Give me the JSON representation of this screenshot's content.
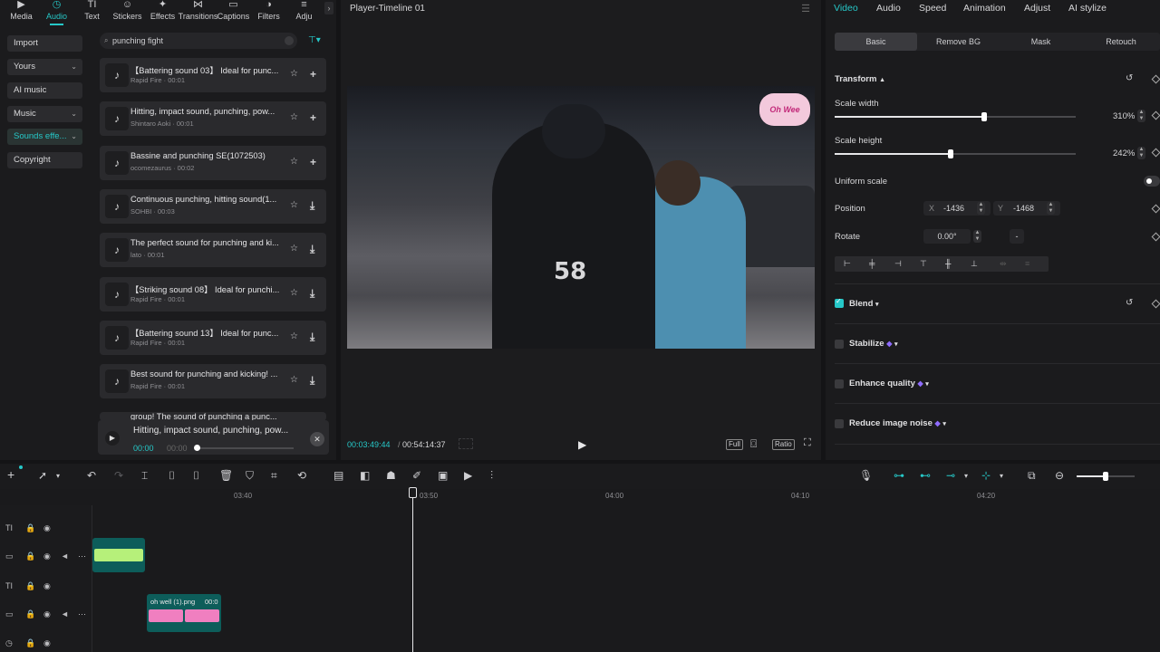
{
  "top_tabs": [
    {
      "label": "Media",
      "icon": "media-icon",
      "glyph": "▶"
    },
    {
      "label": "Audio",
      "icon": "audio-icon",
      "glyph": "◷",
      "active": true
    },
    {
      "label": "Text",
      "icon": "text-icon",
      "glyph": "TI"
    },
    {
      "label": "Stickers",
      "icon": "stickers-icon",
      "glyph": "☺"
    },
    {
      "label": "Effects",
      "icon": "effects-icon",
      "glyph": "✦"
    },
    {
      "label": "Transitions",
      "icon": "transitions-icon",
      "glyph": "⋈"
    },
    {
      "label": "Captions",
      "icon": "captions-icon",
      "glyph": "▭"
    },
    {
      "label": "Filters",
      "icon": "filters-icon",
      "glyph": "◑"
    },
    {
      "label": "Adju",
      "icon": "adjust-icon",
      "glyph": "≡"
    }
  ],
  "left_nav": [
    {
      "label": "Import",
      "chevron": false
    },
    {
      "label": "Yours",
      "chevron": true
    },
    {
      "label": "AI music",
      "chevron": false
    },
    {
      "label": "Music",
      "chevron": true
    },
    {
      "label": "Sounds effe...",
      "chevron": true,
      "selected": true
    },
    {
      "label": "Copyright",
      "chevron": false
    }
  ],
  "search": {
    "value": "punching fight"
  },
  "sounds": [
    {
      "title": "【Battering sound 03】 Ideal for punc...",
      "sub": "Rapid Fire · 00:01",
      "action": "+"
    },
    {
      "title": "Hitting, impact sound, punching, pow...",
      "sub": "Shintaro Aoki · 00:01",
      "action": "+"
    },
    {
      "title": "Bassine and punching SE(1072503)",
      "sub": "ocomezaurus · 00:02",
      "action": "+"
    },
    {
      "title": "Continuous punching, hitting sound(1...",
      "sub": "SOHBI · 00:03",
      "action": "⤓"
    },
    {
      "title": "The perfect sound for punching and ki...",
      "sub": "lato · 00:01",
      "action": "⤓"
    },
    {
      "title": "【Striking sound 08】 Ideal for punchi...",
      "sub": "Rapid Fire · 00:01",
      "action": "⤓"
    },
    {
      "title": "【Battering sound 13】 Ideal for punc...",
      "sub": "Rapid Fire · 00:01",
      "action": "⤓"
    },
    {
      "title": "Best sound for punching and kicking! ...",
      "sub": "Rapid Fire · 00:01",
      "action": "⤓"
    }
  ],
  "sound_partial": "group! The sound of punching a punc...",
  "mini_player": {
    "title": "Hitting, impact sound, punching, pow...",
    "current": "00:00",
    "total": "00:00",
    "progress": 0.0
  },
  "preview": {
    "title": "Player-Timeline 01",
    "current_time": "00:03:49:44",
    "total_time": "00:54:14:37",
    "jersey_number": "58",
    "sticker_text": "Oh Wee",
    "btn_full": "Full",
    "btn_ratio": "Ratio"
  },
  "inspector": {
    "tabs": [
      "Video",
      "Audio",
      "Speed",
      "Animation",
      "Adjust",
      "AI stylize"
    ],
    "subtabs": [
      "Basic",
      "Remove BG",
      "Mask",
      "Retouch"
    ],
    "transform_label": "Transform",
    "scale_width_label": "Scale width",
    "scale_width_value": "310%",
    "scale_width_level": 0.62,
    "scale_height_label": "Scale height",
    "scale_height_value": "242%",
    "scale_height_level": 0.48,
    "uniform_scale_label": "Uniform scale",
    "position_label": "Position",
    "pos_x_axis": "X",
    "pos_x": "-1436",
    "pos_y_axis": "Y",
    "pos_y": "-1468",
    "rotate_label": "Rotate",
    "rotate_value": "0.00°",
    "rotate_extra": "-",
    "blend_label": "Blend",
    "stabilize_label": "Stabilize",
    "enhance_label": "Enhance quality",
    "noise_label": "Reduce image noise"
  },
  "timeline": {
    "ticks": [
      "03:40",
      "03:50",
      "04:00",
      "04:10",
      "04:20"
    ],
    "sticker_clip_name": "oh well (1).png",
    "sticker_clip_time": "00:0",
    "zoom_level": 0.5
  },
  "colors": {
    "accent": "#26c8c8",
    "audio_clip": "#b6f07a",
    "sticker_clip": "#f07fc0"
  }
}
